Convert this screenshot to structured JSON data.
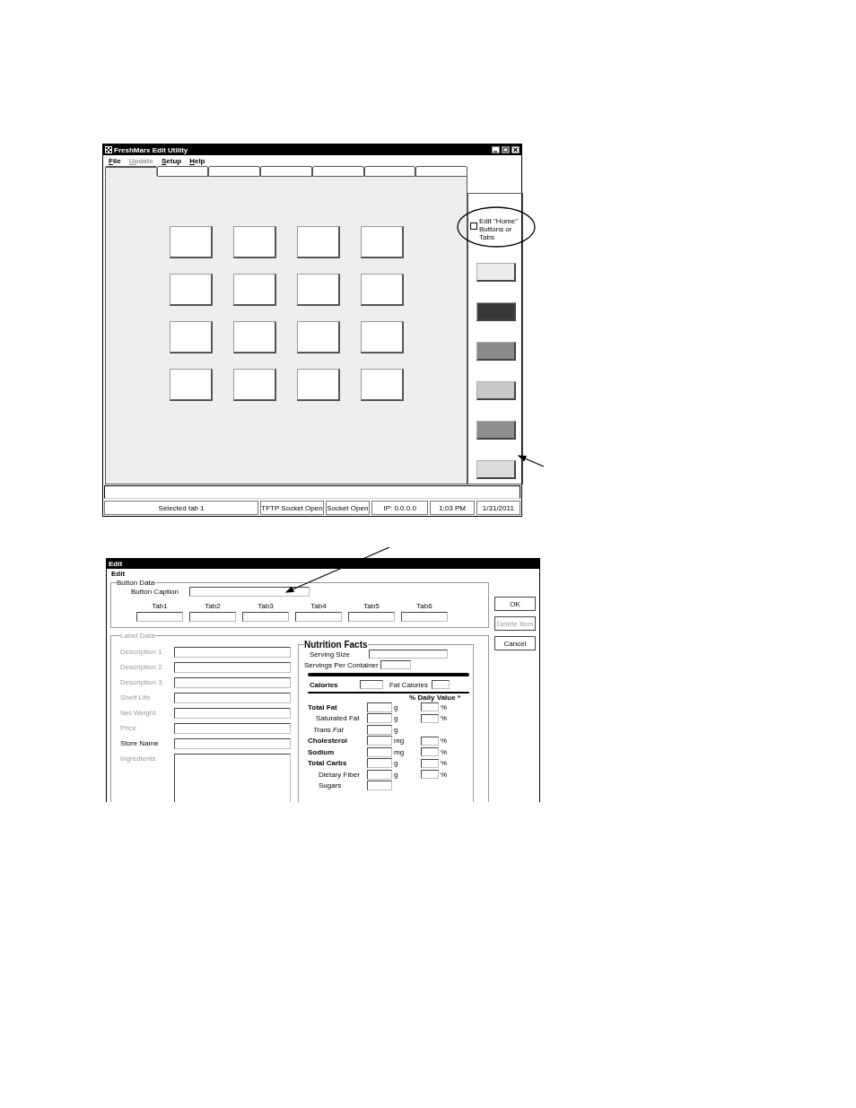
{
  "main_window": {
    "title": "FreshMarx Edit Utility",
    "menu": [
      {
        "label": "File",
        "disabled": false
      },
      {
        "label": "Update",
        "disabled": true
      },
      {
        "label": "Setup",
        "disabled": false
      },
      {
        "label": "Help",
        "disabled": false
      }
    ],
    "tabs": [
      {
        "selected": true
      },
      {
        "selected": false
      },
      {
        "selected": false
      },
      {
        "selected": false
      },
      {
        "selected": false
      },
      {
        "selected": false
      },
      {
        "selected": false
      }
    ],
    "home_toggle": {
      "label": "Edit \"Home\" Buttons or Tabs",
      "checked": false
    },
    "color_buttons": [
      {
        "color": "#ececec"
      },
      {
        "color": "#383838"
      },
      {
        "color": "#8a8a8a"
      },
      {
        "color": "#c8c8c8"
      },
      {
        "color": "#8e8e8e"
      },
      {
        "color": "#dcdcdc"
      }
    ],
    "status_bar": [
      "Selected tab 1",
      "TFTP Socket Open",
      "Socket Open",
      "IP: 0.0.0.0",
      "1:03 PM",
      "1/31/2011"
    ]
  },
  "edit_dialog": {
    "title": "Edit",
    "menu": [
      "Edit"
    ],
    "button_data": {
      "legend": "Button Data",
      "caption_label": "Button Caption",
      "tabs": [
        "Tab1",
        "Tab2",
        "Tab3",
        "Tab4",
        "Tab5",
        "Tab6"
      ]
    },
    "buttons": [
      {
        "label": "OK",
        "disabled": false
      },
      {
        "label": "Delete Item",
        "disabled": true
      },
      {
        "label": "Cancel",
        "disabled": false
      }
    ],
    "label_data": {
      "legend": "Label Data",
      "fields": [
        {
          "label": "Description 1",
          "disabled": true,
          "kind": "line"
        },
        {
          "label": "Description 2",
          "disabled": true,
          "kind": "line"
        },
        {
          "label": "Description 3",
          "disabled": true,
          "kind": "line"
        },
        {
          "label": "Shelf Life",
          "disabled": true,
          "kind": "line"
        },
        {
          "label": "Net Weight",
          "disabled": true,
          "kind": "line"
        },
        {
          "label": "Price",
          "disabled": true,
          "kind": "line"
        },
        {
          "label": "Store Name",
          "disabled": false,
          "kind": "line"
        },
        {
          "label": "Ingredients",
          "disabled": true,
          "kind": "area"
        }
      ]
    },
    "nutrition": {
      "title": "Nutrition Facts",
      "serving_size_label": "Serving Size",
      "servings_per_container_label": "Servings Per Container",
      "calories_label": "Calories",
      "fat_calories_label": "Fat Calories",
      "daily_value_label": "% Daily Value *",
      "rows": [
        {
          "label": "Total Fat",
          "kind": "main",
          "unit": "g",
          "percent": "%"
        },
        {
          "label": "Saturated Fat",
          "kind": "sub",
          "unit": "g",
          "percent": "%"
        },
        {
          "label": "Trans Fat",
          "kind": "italic",
          "unit": "g"
        },
        {
          "label": "Cholesterol",
          "kind": "main",
          "unit": "mg",
          "percent": "%"
        },
        {
          "label": "Sodium",
          "kind": "main",
          "unit": "mg",
          "percent": "%"
        },
        {
          "label": "Total Carbs",
          "kind": "main",
          "unit": "g",
          "percent": "%"
        },
        {
          "label": "Dietary Fiber",
          "kind": "subsub",
          "unit": "g",
          "percent": "%"
        },
        {
          "label": "Sugars",
          "kind": "subsub"
        }
      ]
    }
  }
}
